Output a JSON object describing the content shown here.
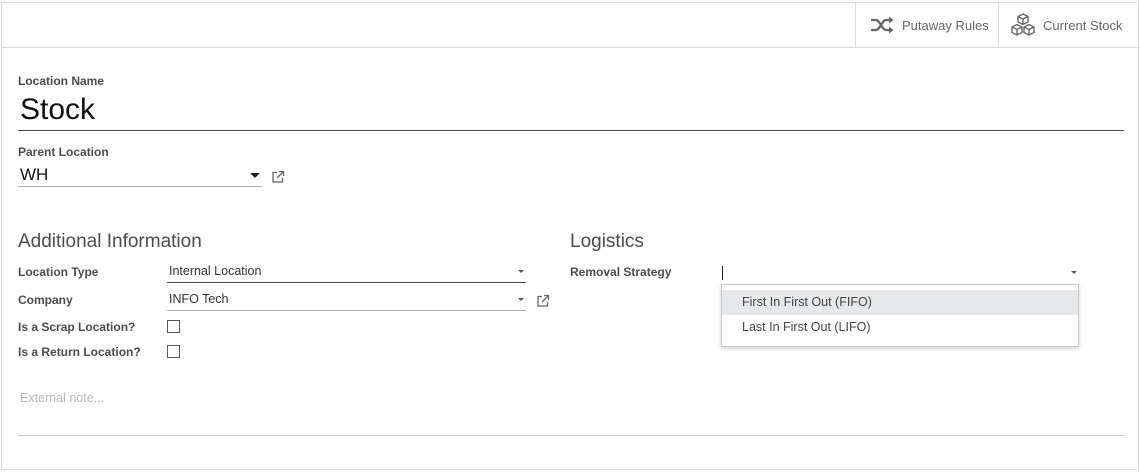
{
  "buttons": {
    "putaway_label": "Putaway Rules",
    "stock_label": "Current Stock"
  },
  "form": {
    "name_label": "Location Name",
    "name_value": "Stock",
    "parent_label": "Parent Location",
    "parent_value": "WH"
  },
  "additional": {
    "title": "Additional Information",
    "location_type_label": "Location Type",
    "location_type_value": "Internal Location",
    "company_label": "Company",
    "company_value": "INFO Tech",
    "scrap_label": "Is a Scrap Location?",
    "return_label": "Is a Return Location?"
  },
  "logistics": {
    "title": "Logistics",
    "removal_label": "Removal Strategy",
    "removal_value": "",
    "options": [
      "First In First Out (FIFO)",
      "Last In First Out (LIFO)"
    ]
  },
  "note": {
    "placeholder": "External note..."
  },
  "colors": {
    "label": "#4c4c4c",
    "icon": "#666666",
    "border": "#d8dadd",
    "highlight": "#e6e8ea"
  },
  "icons": [
    "shuffle-icon",
    "cubes-icon",
    "external-link-icon",
    "caret-down-icon"
  ]
}
